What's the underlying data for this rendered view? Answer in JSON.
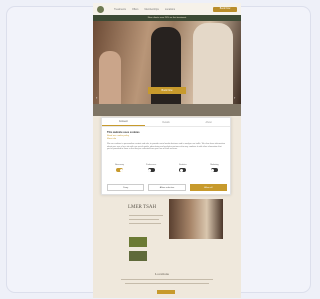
{
  "site": {
    "nav": {
      "links": [
        "Treatments",
        "Offers",
        "Memberships",
        "Locations"
      ],
      "cta": "Book Now"
    },
    "banner": "New clients save 20% on first treatment",
    "hero": {
      "cta": "Book Now"
    },
    "section": {
      "title": "LMER TSAH"
    },
    "locations": {
      "title": "Locations"
    }
  },
  "cookie_modal": {
    "tabs": [
      "Consent",
      "Details",
      "About"
    ],
    "title": "This website uses cookies",
    "links": [
      "Read our cookie policy",
      "More info"
    ],
    "body": "We use cookies to personalise content and ads, to provide social media features and to analyse our traffic. We also share information about your use of our site with our social media, advertising and analytics partners who may combine it with other information that you've provided to them or that they've collected from your use of their services.",
    "toggles": [
      {
        "label": "Necessary",
        "on": true
      },
      {
        "label": "Preferences",
        "on": false
      },
      {
        "label": "Statistics",
        "on": false
      },
      {
        "label": "Marketing",
        "on": false
      }
    ],
    "buttons": {
      "deny": "Deny",
      "allow_selection": "Allow selection",
      "allow_all": "Allow all"
    }
  },
  "colors": {
    "accent": "#c79a2c",
    "olive": "#6b7a34",
    "banner": "#3c4a34"
  }
}
